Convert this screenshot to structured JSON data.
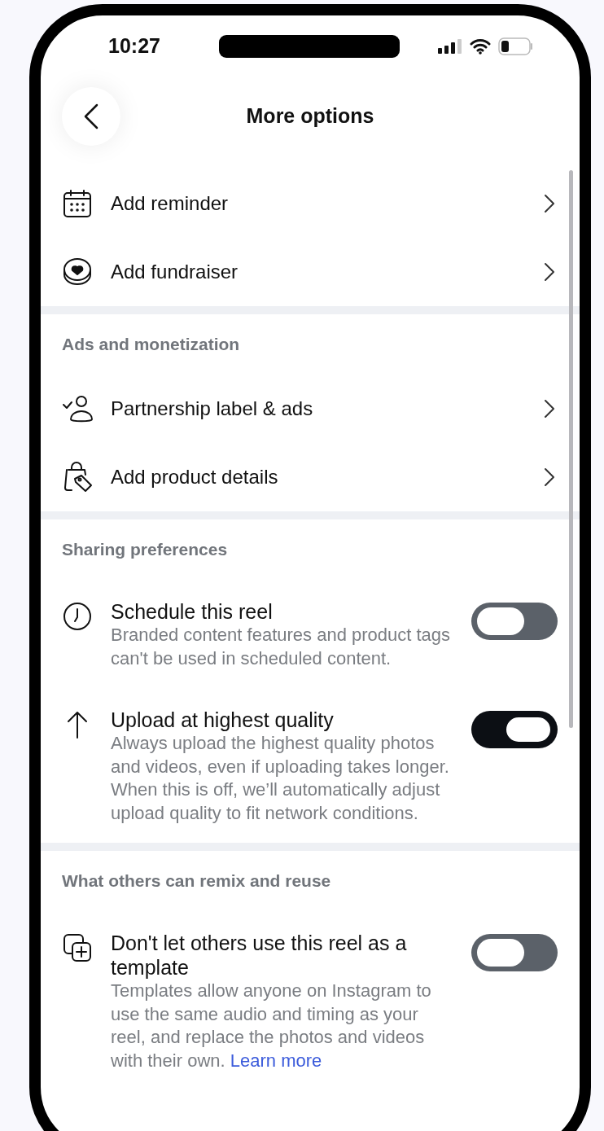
{
  "status_bar": {
    "time": "10:27"
  },
  "header": {
    "title": "More options"
  },
  "sections": [
    {
      "rows": [
        {
          "kind": "link",
          "label": "Add reminder"
        },
        {
          "kind": "link",
          "label": "Add fundraiser"
        }
      ]
    },
    {
      "title": "Ads and monetization",
      "rows": [
        {
          "kind": "link",
          "label": "Partnership label & ads"
        },
        {
          "kind": "link",
          "label": "Add product details"
        }
      ]
    },
    {
      "title": "Sharing preferences",
      "rows": [
        {
          "kind": "toggle",
          "label": "Schedule this reel",
          "description": "Branded content features and product tags can't be used in scheduled content.",
          "on": false
        },
        {
          "kind": "toggle",
          "label": "Upload at highest quality",
          "description": "Always upload the highest quality photos and videos, even if uploading takes longer. When this is off, we’ll automatically adjust upload quality to fit network conditions.",
          "on": true
        }
      ]
    },
    {
      "title": "What others can remix and reuse",
      "rows": [
        {
          "kind": "toggle",
          "label": "Don't let others use this reel as a template",
          "description": "Templates allow anyone on Instagram to use the same audio and timing as your reel, and replace the photos and videos with their own.",
          "link": "Learn more",
          "on": false
        }
      ]
    }
  ]
}
